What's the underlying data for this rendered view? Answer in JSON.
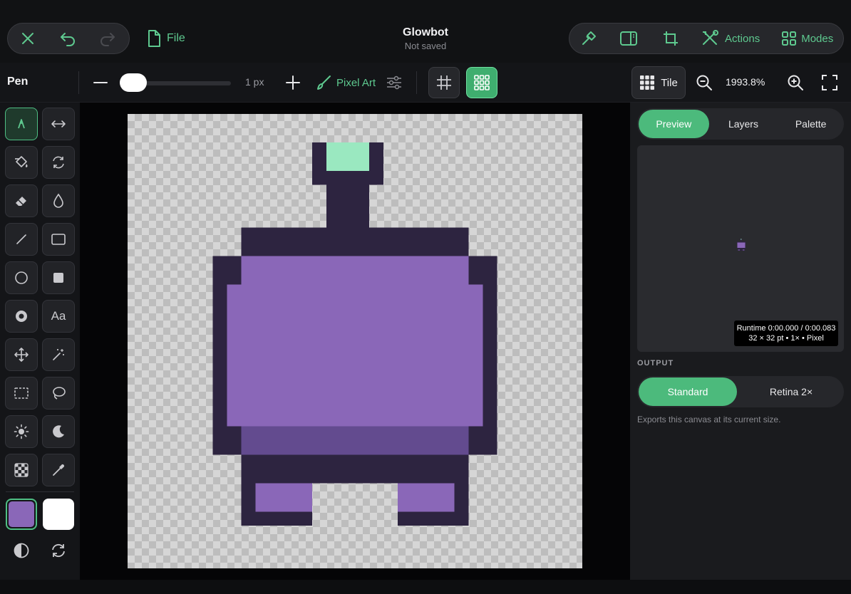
{
  "app": {
    "document_title": "Glowbot",
    "document_status": "Not saved",
    "file_label": "File",
    "actions_label": "Actions",
    "modes_label": "Modes",
    "accent_color": "#5ec98f"
  },
  "toolbar": {
    "tool_name": "Pen",
    "brush_size_label": "1 px",
    "brush_size_value": 1,
    "brush_mode_label": "Pixel Art",
    "tile_label": "Tile",
    "zoom_label": "1993.8%",
    "pixel_grid_active": true
  },
  "tools": [
    {
      "name": "pen",
      "icon": "pen-icon",
      "active": true
    },
    {
      "name": "symmetry",
      "icon": "arrows-horizontal-icon"
    },
    {
      "name": "fill",
      "icon": "paint-bucket-icon"
    },
    {
      "name": "replace",
      "icon": "refresh-icon"
    },
    {
      "name": "eraser",
      "icon": "eraser-icon"
    },
    {
      "name": "blur",
      "icon": "drop-icon"
    },
    {
      "name": "line",
      "icon": "line-icon"
    },
    {
      "name": "rectangle",
      "icon": "rectangle-icon"
    },
    {
      "name": "ellipse",
      "icon": "circle-icon"
    },
    {
      "name": "filled-rectangle",
      "icon": "filled-square-icon"
    },
    {
      "name": "filled-ellipse",
      "icon": "filled-circle-icon"
    },
    {
      "name": "text",
      "icon": "text-icon",
      "label": "Aa"
    },
    {
      "name": "move",
      "icon": "move-icon"
    },
    {
      "name": "magic-wand",
      "icon": "magic-wand-icon"
    },
    {
      "name": "rect-select",
      "icon": "marquee-icon"
    },
    {
      "name": "lasso",
      "icon": "lasso-icon"
    },
    {
      "name": "lighten",
      "icon": "sun-icon"
    },
    {
      "name": "darken",
      "icon": "moon-icon"
    },
    {
      "name": "dither",
      "icon": "checker-icon"
    },
    {
      "name": "eyedropper",
      "icon": "eyedropper-icon"
    }
  ],
  "colors": {
    "primary": "#8a67b8",
    "secondary": "#ffffff"
  },
  "sprite_palette": {
    "outline": "#2d2440",
    "body": "#8a67b8",
    "shadow": "#634b8f",
    "glow": "#9ae8c0"
  },
  "right_panel": {
    "tabs": [
      {
        "label": "Preview",
        "active": true
      },
      {
        "label": "Layers",
        "active": false
      },
      {
        "label": "Palette",
        "active": false
      }
    ],
    "runtime_line1": "Runtime 0:00.000 / 0:00.083",
    "runtime_line2": "32 × 32 pt • 1× • Pixel",
    "output_label": "OUTPUT",
    "output_options": [
      {
        "label": "Standard",
        "active": true
      },
      {
        "label": "Retina 2×",
        "active": false
      }
    ],
    "output_description": "Exports this canvas at its current size."
  }
}
